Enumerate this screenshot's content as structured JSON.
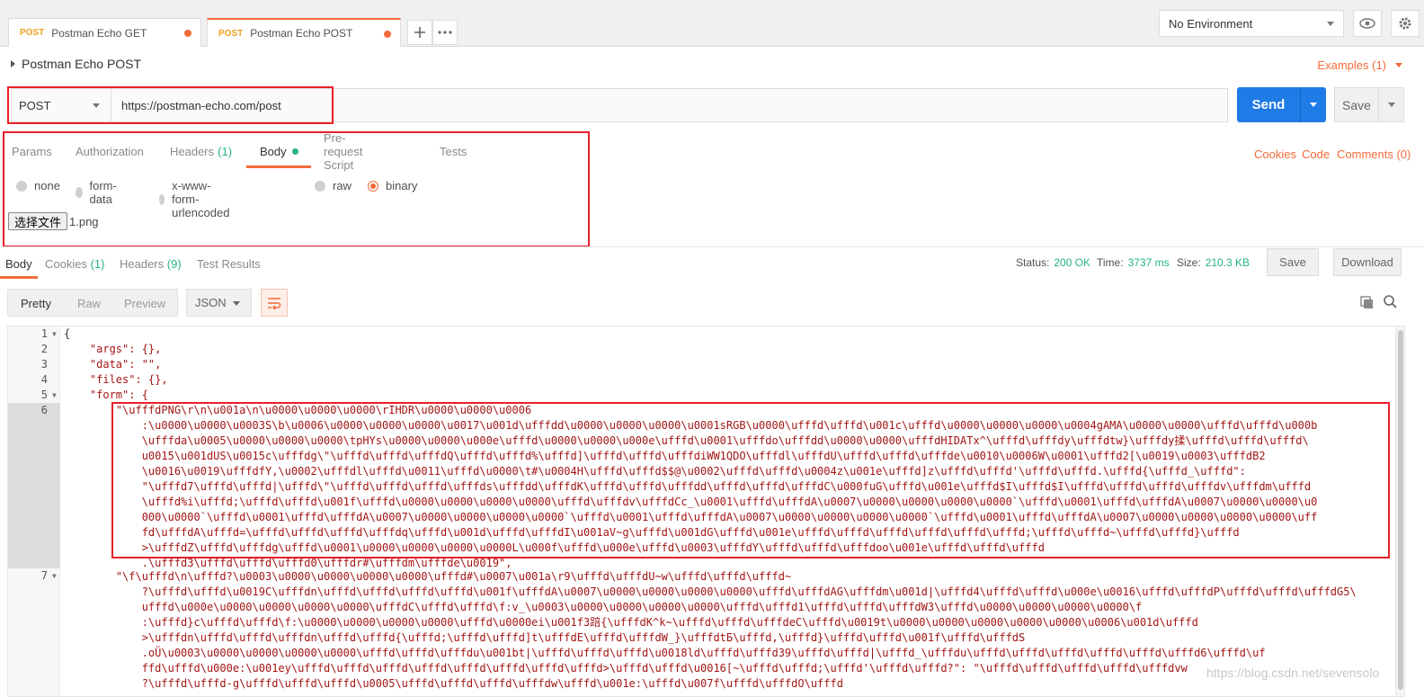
{
  "tabs": [
    {
      "method": "POST",
      "name": "Postman Echo GET"
    },
    {
      "method": "POST",
      "name": "Postman Echo POST"
    }
  ],
  "environment": {
    "selected": "No Environment"
  },
  "request": {
    "name": "Postman Echo POST",
    "examples_label": "Examples (1)",
    "method": "POST",
    "url": "https://postman-echo.com/post",
    "send_label": "Send",
    "save_label": "Save"
  },
  "request_tabs": [
    {
      "label": "Params",
      "count": ""
    },
    {
      "label": "Authorization",
      "count": ""
    },
    {
      "label": "Headers",
      "count": "(1)"
    },
    {
      "label": "Body",
      "count": ""
    },
    {
      "label": "Pre-request Script",
      "count": ""
    },
    {
      "label": "Tests",
      "count": ""
    }
  ],
  "request_links": {
    "cookies": "Cookies",
    "code": "Code",
    "comments": "Comments (0)"
  },
  "body_modes": [
    {
      "label": "none",
      "selected": false
    },
    {
      "label": "form-data",
      "selected": false
    },
    {
      "label": "x-www-form-urlencoded",
      "selected": false
    },
    {
      "label": "raw",
      "selected": false
    },
    {
      "label": "binary",
      "selected": true
    }
  ],
  "file": {
    "button_label": "选择文件",
    "name": "1.png"
  },
  "response_tabs": [
    {
      "label": "Body",
      "count": ""
    },
    {
      "label": "Cookies",
      "count": "(1)"
    },
    {
      "label": "Headers",
      "count": "(9)"
    },
    {
      "label": "Test Results",
      "count": ""
    }
  ],
  "status": {
    "status_label": "Status:",
    "status_value": "200 OK",
    "time_label": "Time:",
    "time_value": "3737 ms",
    "size_label": "Size:",
    "size_value": "210.3 KB"
  },
  "response_buttons": {
    "save": "Save",
    "download": "Download"
  },
  "view_options": {
    "pretty": "Pretty",
    "raw": "Raw",
    "preview": "Preview",
    "format": "JSON"
  },
  "line_numbers": [
    "1",
    "2",
    "3",
    "4",
    "5",
    "6",
    "7"
  ],
  "code": {
    "l1": "{",
    "l2": "    \"args\": {},",
    "l3": "    \"data\": \"\",",
    "l4": "    \"files\": {},",
    "l5": "    \"form\": {",
    "l6": [
      "        \"\\ufffdPNG\\r\\n\\u001a\\n\\u0000\\u0000\\u0000\\rIHDR\\u0000\\u0000\\u0006",
      "            :\\u0000\\u0000\\u0003S\\b\\u0006\\u0000\\u0000\\u0000\\u0017\\u001d\\ufffdd\\u0000\\u0000\\u0000\\u0001sRGB\\u0000\\ufffd\\ufffd\\u001c\\ufffd\\u0000\\u0000\\u0000\\u0004gAMA\\u0000\\u0000\\ufffd\\ufffd\\u000b",
      "            \\ufffda\\u0005\\u0000\\u0000\\u0000\\tpHYs\\u0000\\u0000\\u000e\\ufffd\\u0000\\u0000\\u000e\\ufffd\\u0001\\ufffdo\\ufffdd\\u0000\\u0000\\ufffdHIDATx^\\ufffd\\ufffdy\\ufffdtw}\\ufffdy揉\\ufffd\\ufffd\\ufffd\\",
      "            u0015\\u001dUS\\u0015c\\ufffdg\\\"\\ufffd\\ufffd\\ufffdQ\\ufffd\\ufffd%\\ufffd]\\ufffd\\ufffd\\ufffdiWW1QDO\\ufffdl\\ufffdU\\ufffd\\ufffd\\ufffde\\u0010\\u0006W\\u0001\\ufffd2[\\u0019\\u0003\\ufffdB2",
      "            \\u0016\\u0019\\ufffdfY,\\u0002\\ufffdl\\ufffd\\u0011\\ufffd\\u0000\\t#\\u0004H\\ufffd\\ufffd$$@\\u0002\\ufffd\\ufffd\\u0004z\\u001e\\ufffd]z\\ufffd\\ufffd'\\ufffd\\ufffd.\\ufffd{\\ufffd_\\ufffd\":",
      "            \"\\ufffd7\\ufffd\\ufffd|\\ufffd\\\"\\ufffd\\ufffd\\ufffd\\ufffds\\ufffdd\\ufffdK\\ufffd\\ufffd\\ufffdd\\ufffd\\ufffd\\ufffdC\\u000fuG\\ufffd\\u001e\\ufffd$I\\ufffd$I\\ufffd\\ufffd\\ufffd\\ufffdv\\ufffdm\\ufffd",
      "            \\ufffd%i\\ufffd;\\ufffd\\ufffd\\u001f\\ufffd\\u0000\\u0000\\u0000\\u0000\\ufffd\\ufffdv\\ufffdCc_\\u0001\\ufffd\\ufffdA\\u0007\\u0000\\u0000\\u0000\\u0000`\\ufffd\\u0001\\ufffd\\ufffdA\\u0007\\u0000\\u0000\\u0",
      "            000\\u0000`\\ufffd\\u0001\\ufffd\\ufffdA\\u0007\\u0000\\u0000\\u0000\\u0000`\\ufffd\\u0001\\ufffd\\ufffdA\\u0007\\u0000\\u0000\\u0000\\u0000`\\ufffd\\u0001\\ufffd\\ufffdA\\u0007\\u0000\\u0000\\u0000\\u0000\\uff",
      "            fd\\ufffdA\\ufffd=\\ufffd\\ufffd\\ufffd\\ufffdq\\ufffd\\u001d\\ufffd\\ufffdI\\u001aV~g\\ufffd\\u001dG\\ufffd\\u001e\\ufffd\\ufffd\\ufffd\\ufffd\\ufffd\\ufffd;\\ufffd\\ufffd~\\ufffd\\ufffd}\\ufffd",
      "            >\\ufffdZ\\ufffd\\ufffdg\\ufffd\\u0001\\u0000\\u0000\\u0000\\u0000L\\u000f\\ufffd\\u000e\\ufffd\\u0003\\ufffdY\\ufffd\\ufffd\\ufffdoo\\u001e\\ufffd\\ufffd\\ufffd",
      "            .\\ufffd3\\ufffd\\ufffd\\ufffd0\\ufffdr#\\ufffdm\\ufffde\\u0019\","
    ],
    "l7": [
      "        \"\\f\\ufffd\\n\\ufffd?\\u0003\\u0000\\u0000\\u0000\\u0000\\ufffd#\\u0007\\u001a\\r9\\ufffd\\ufffdU~w\\ufffd\\ufffd\\ufffd~",
      "            ?\\ufffd\\ufffd\\u0019C\\ufffdn\\ufffd\\ufffd\\ufffd\\ufffd\\u001f\\ufffdA\\u0007\\u0000\\u0000\\u0000\\u0000\\ufffd\\ufffdAG\\ufffdm\\u001d|\\ufffd4\\ufffd\\ufffd\\u000e\\u0016\\ufffd\\ufffdP\\ufffd\\ufffd\\ufffdG5\\",
      "            ufffd\\u000e\\u0000\\u0000\\u0000\\u0000\\ufffdC\\ufffd\\ufffd\\f:v_\\u0003\\u0000\\u0000\\u0000\\u0000\\ufffd\\ufffd1\\ufffd\\ufffd\\ufffdW3\\ufffd\\u0000\\u0000\\u0000\\u0000\\f",
      "            :\\ufffd}c\\ufffd\\ufffd\\f:\\u0000\\u0000\\u0000\\u0000\\ufffd\\u0000ei\\u001f3踣{\\ufffdK^k~\\ufffd\\ufffd\\ufffdeC\\ufffd\\u0019t\\u0000\\u0000\\u0000\\u0000\\u0000\\u0006\\u001d\\ufffd",
      "            >\\ufffdn\\ufffd\\ufffd\\ufffdn\\ufffd\\ufffd{\\ufffd;\\ufffd\\ufffd]t\\ufffdE\\ufffd\\ufffdW_}\\ufffdtБ\\ufffd,\\ufffd}\\ufffd\\ufffd\\u001f\\ufffd\\ufffdS",
      "            .oÜ\\u0003\\u0000\\u0000\\u0000\\u0000\\ufffd\\ufffd\\ufffdu\\u001bt|\\ufffd\\ufffd\\ufffd\\u0018ld\\ufffd\\ufffd39\\ufffd\\ufffd|\\ufffd_\\ufffdu\\ufffd\\ufffd\\ufffd\\ufffd\\ufffd\\ufffd6\\ufffd\\uf",
      "            ffd\\ufffd\\u000e:\\u001ey\\ufffd\\ufffd\\ufffd\\ufffd\\ufffd\\ufffd\\ufffd\\ufffd>\\ufffd\\ufffd\\u0016[~\\ufffd\\ufffd;\\ufffd'\\ufffd\\ufffd?\": \"\\ufffd\\ufffd\\ufffd\\ufffd\\ufffdvw",
      "            ?\\ufffd\\ufffd-g\\ufffd\\ufffd\\ufffd\\u0005\\ufffd\\ufffd\\ufffd\\ufffdw\\ufffd\\u001e:\\ufffd\\u007f\\ufffd\\ufffdO\\ufffd"
    ]
  },
  "watermark": "https://blog.csdn.net/sevensolo",
  "colors": {
    "accent": "#f26b3a",
    "send": "#1f7be6",
    "green": "#26b47f",
    "highlight": "#e8202a"
  }
}
